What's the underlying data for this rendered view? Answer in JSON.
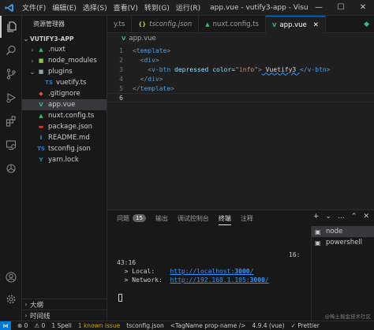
{
  "titlebar": {
    "menu": [
      "文件(F)",
      "编辑(E)",
      "选择(S)",
      "查看(V)",
      "转到(G)",
      "运行(R)"
    ],
    "title": "app.vue - vutify3-app - Visu...",
    "controls": {
      "minimize": "—",
      "maximize": "☐",
      "close": "✕"
    }
  },
  "sidebar": {
    "title": "资源管理器",
    "root": "VUTIFY3-APP",
    "items": [
      {
        "label": ".nuxt",
        "type": "folder"
      },
      {
        "label": "node_modules",
        "type": "folder"
      },
      {
        "label": "plugins",
        "type": "folder-open"
      },
      {
        "label": "vuetify.ts",
        "type": "ts"
      },
      {
        "label": ".gitignore",
        "type": "git"
      },
      {
        "label": "app.vue",
        "type": "vue"
      },
      {
        "label": "nuxt.config.ts",
        "type": "nuxt"
      },
      {
        "label": "package.json",
        "type": "json"
      },
      {
        "label": "README.md",
        "type": "md"
      },
      {
        "label": "tsconfig.json",
        "type": "json"
      },
      {
        "label": "yarn.lock",
        "type": "yarn"
      }
    ],
    "outline": "大纲",
    "timeline": "时间线"
  },
  "tabs": [
    {
      "label": "y.ts",
      "icon": "",
      "active": false
    },
    {
      "label": "tsconfig.json",
      "icon": "{}",
      "active": false
    },
    {
      "label": "nuxt.config.ts",
      "icon": "▲",
      "active": false
    },
    {
      "label": "app.vue",
      "icon": "V",
      "active": true
    }
  ],
  "breadcrumb": "app.vue",
  "editor": {
    "lines": [
      {
        "n": "1",
        "indent": "",
        "open": "<",
        "tag": "template",
        "close": ">",
        "rest": ""
      },
      {
        "n": "2",
        "indent": "  ",
        "open": "<",
        "tag": "div",
        "close": ">",
        "rest": ""
      },
      {
        "n": "3",
        "indent": "    ",
        "open": "<",
        "tag": "v-btn",
        "close": "",
        "rest": "depressed color=\"info\"> Vuetify3 </v-btn>"
      },
      {
        "n": "4",
        "indent": "  ",
        "open": "</",
        "tag": "div",
        "close": ">",
        "rest": ""
      },
      {
        "n": "5",
        "indent": "",
        "open": "</",
        "tag": "template",
        "close": ">",
        "rest": ""
      },
      {
        "n": "6",
        "indent": "",
        "open": "",
        "tag": "",
        "close": "",
        "rest": ""
      }
    ],
    "line3": {
      "attr1": "depressed",
      "attr2": "color",
      "eq": "=",
      "value": "\"info\"",
      "gt": ">",
      "text": " Vuetify3 ",
      "endtag": "</v-btn>"
    }
  },
  "panel": {
    "tabs": [
      "问题",
      "输出",
      "调试控制台",
      "终端",
      "注释"
    ],
    "problems_count": "15",
    "active_tab": "终端",
    "terminal": {
      "time": "43:16",
      "time_right": "16:",
      "local_label": "  > Local:    ",
      "local_url_base": "http://localhost:",
      "local_port": "3000",
      "local_slash": "/",
      "network_label": "  > Network:  ",
      "network_url_base": "http://192.168.1.105:",
      "network_port": "3000",
      "network_slash": "/"
    },
    "terminals": [
      "node",
      "powershell"
    ]
  },
  "statusbar": {
    "errors": "⊗ 0",
    "warnings": "⚠ 0",
    "spell": "1 Spell",
    "issue": "1 known issue",
    "lang": "tsconfig.json",
    "tagname": "<TagName prop-name />",
    "version": "4.9.4 (vue)",
    "prettier": "✓ Prettier"
  },
  "watermark": "@稀土掘金技术社区",
  "colors": {
    "accent": "#0078d4",
    "tag": "#569cd6",
    "attr": "#9cdcfe",
    "string": "#ce9178",
    "link": "#3794ff"
  }
}
